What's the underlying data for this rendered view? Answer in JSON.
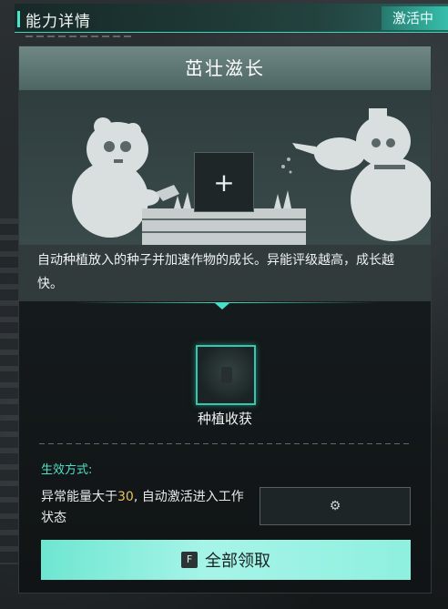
{
  "header": {
    "title": "能力详情",
    "status": "激活中"
  },
  "panel": {
    "title": "茁壮滋长",
    "slot_icon": "plus-icon",
    "description": "自动种植放入的种子并加速作物的成长。异能评级越高，成长越快。"
  },
  "item": {
    "label": "种植收获",
    "icon": "harvest-icon"
  },
  "effect": {
    "label": "生效方式:",
    "text_before": "异常能量大于",
    "threshold": "30",
    "text_after": ", 自动激活进入工作状态"
  },
  "settings_button": {
    "icon": "gear-icon"
  },
  "claim_button": {
    "key": "F",
    "label": "全部领取"
  },
  "colors": {
    "accent": "#48e6cc",
    "highlight": "#e6c262",
    "claim_button": "#8ef0df"
  }
}
